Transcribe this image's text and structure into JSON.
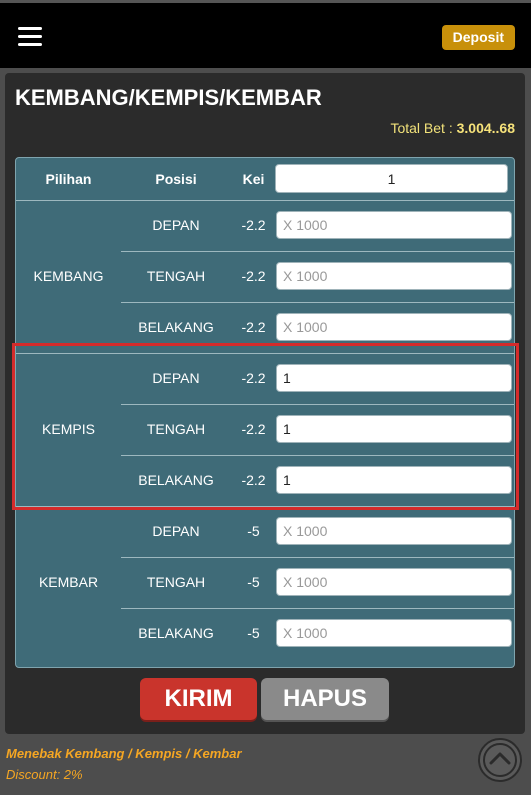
{
  "header": {
    "deposit_label": "Deposit"
  },
  "panel": {
    "title": "KEMBANG/KEMPIS/KEMBAR",
    "total_bet_label": "Total Bet : ",
    "total_bet_value": "3.004..68"
  },
  "table": {
    "col_pilihan": "Pilihan",
    "col_posisi": "Posisi",
    "col_kei": "Kei",
    "top_input_value": "1",
    "groups": [
      {
        "name": "KEMBANG",
        "rows": [
          {
            "pos": "DEPAN",
            "kei": "-2.2",
            "value": "",
            "placeholder": "X 1000"
          },
          {
            "pos": "TENGAH",
            "kei": "-2.2",
            "value": "",
            "placeholder": "X 1000"
          },
          {
            "pos": "BELAKANG",
            "kei": "-2.2",
            "value": "",
            "placeholder": "X 1000"
          }
        ]
      },
      {
        "name": "KEMPIS",
        "rows": [
          {
            "pos": "DEPAN",
            "kei": "-2.2",
            "value": "1",
            "placeholder": "X 1000"
          },
          {
            "pos": "TENGAH",
            "kei": "-2.2",
            "value": "1",
            "placeholder": "X 1000"
          },
          {
            "pos": "BELAKANG",
            "kei": "-2.2",
            "value": "1",
            "placeholder": "X 1000"
          }
        ]
      },
      {
        "name": "KEMBAR",
        "rows": [
          {
            "pos": "DEPAN",
            "kei": "-5",
            "value": "",
            "placeholder": "X 1000"
          },
          {
            "pos": "TENGAH",
            "kei": "-5",
            "value": "",
            "placeholder": "X 1000"
          },
          {
            "pos": "BELAKANG",
            "kei": "-5",
            "value": "",
            "placeholder": "X 1000"
          }
        ]
      }
    ]
  },
  "buttons": {
    "submit_label": "KIRIM",
    "clear_label": "HAPUS"
  },
  "footer": {
    "description": "Menebak Kembang / Kempis / Kembar",
    "discount": "Discount: 2%"
  },
  "colors": {
    "accent": "#c8900a",
    "table_bg": "#3f6b78",
    "submit": "#c9342c",
    "highlight": "#d42b2b"
  },
  "icons": {
    "menu": "hamburger-icon",
    "scroll_top": "chevron-up-icon"
  }
}
